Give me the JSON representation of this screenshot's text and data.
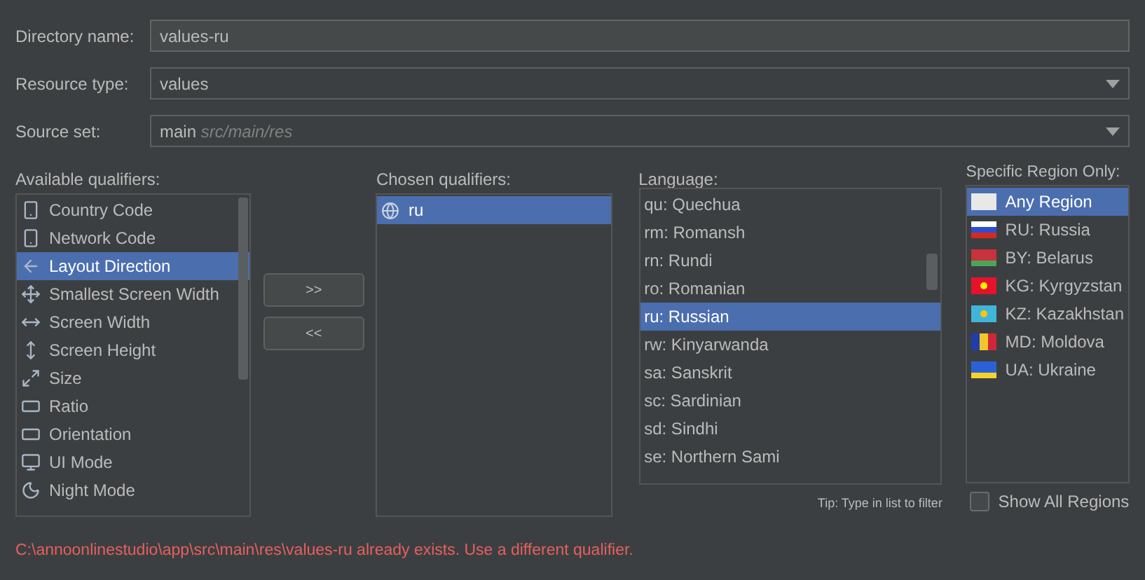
{
  "form": [
    {
      "label": "Directory name:",
      "kind": "text",
      "value": "values-ru"
    },
    {
      "label": "Resource type:",
      "kind": "dropdown",
      "value": "values"
    },
    {
      "label": "Source set:",
      "kind": "dropdown",
      "value": "main",
      "hint": "src/main/res"
    }
  ],
  "available": {
    "label": "Available qualifiers:",
    "items": [
      {
        "text": "Country Code",
        "selected": false
      },
      {
        "text": "Network Code",
        "selected": false
      },
      {
        "text": "Layout Direction",
        "selected": true
      },
      {
        "text": "Smallest Screen Width",
        "selected": false
      },
      {
        "text": "Screen Width",
        "selected": false
      },
      {
        "text": "Screen Height",
        "selected": false
      },
      {
        "text": "Size",
        "selected": false
      },
      {
        "text": "Ratio",
        "selected": false
      },
      {
        "text": "Orientation",
        "selected": false
      },
      {
        "text": "UI Mode",
        "selected": false
      },
      {
        "text": "Night Mode",
        "selected": false
      }
    ]
  },
  "buttons": [
    ">>",
    "<<"
  ],
  "chosen": {
    "label": "Chosen qualifiers:",
    "items": [
      {
        "text": "ru",
        "selected": true
      }
    ]
  },
  "language": {
    "label": "Language:",
    "items": [
      {
        "text": "qu: Quechua",
        "selected": false
      },
      {
        "text": "rm: Romansh",
        "selected": false
      },
      {
        "text": "rn: Rundi",
        "selected": false
      },
      {
        "text": "ro: Romanian",
        "selected": false
      },
      {
        "text": "ru: Russian",
        "selected": true
      },
      {
        "text": "rw: Kinyarwanda",
        "selected": false
      },
      {
        "text": "sa: Sanskrit",
        "selected": false
      },
      {
        "text": "sc: Sardinian",
        "selected": false
      },
      {
        "text": "sd: Sindhi",
        "selected": false
      },
      {
        "text": "se: Northern Sami",
        "selected": false
      }
    ],
    "tip": "Tip: Type in list to filter"
  },
  "region": {
    "label": "Specific Region Only:",
    "items": [
      {
        "text": "Any Region",
        "selected": true
      },
      {
        "text": "RU: Russia",
        "selected": false
      },
      {
        "text": "BY: Belarus",
        "selected": false
      },
      {
        "text": "KG: Kyrgyzstan",
        "selected": false
      },
      {
        "text": "KZ: Kazakhstan",
        "selected": false
      },
      {
        "text": "MD: Moldova",
        "selected": false
      },
      {
        "text": "UA: Ukraine",
        "selected": false
      }
    ],
    "show_all": {
      "label": "Show All Regions",
      "checked": false
    }
  },
  "error": "C:\\annoonlinestudio\\app\\src\\main\\res\\values-ru already exists. Use a different qualifier."
}
